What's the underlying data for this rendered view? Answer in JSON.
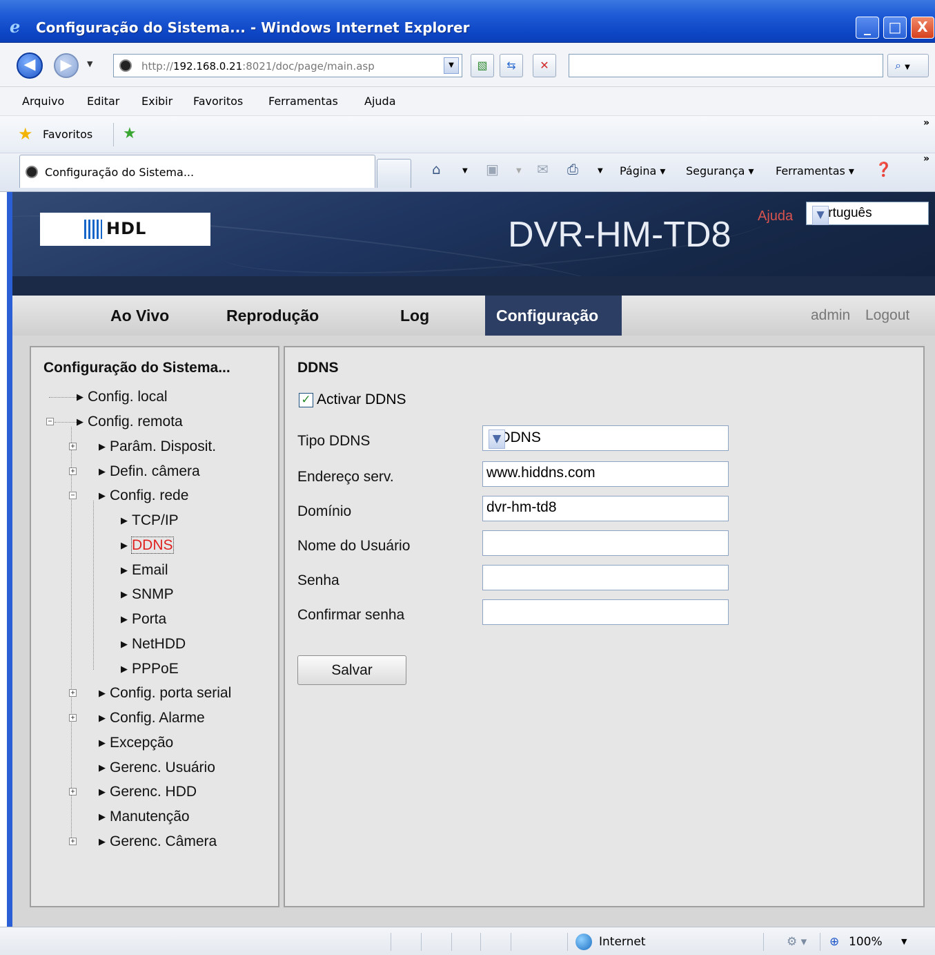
{
  "window": {
    "title": "Configuração do Sistema... - Windows Internet Explorer",
    "minimize_glyph": "_",
    "maximize_glyph": "□",
    "close_glyph": "X"
  },
  "addressbar": {
    "url_prefix": "http://",
    "url_host": "192.168.0.21",
    "url_rest": ":8021/doc/page/main.asp",
    "search_value": ""
  },
  "menu": [
    "Arquivo",
    "Editar",
    "Exibir",
    "Favoritos",
    "Ferramentas",
    "Ajuda"
  ],
  "favorites_bar": {
    "label": "Favoritos"
  },
  "tab": {
    "title": "Configuração do Sistema..."
  },
  "command_bar": {
    "page": "Página ▾",
    "security": "Segurança ▾",
    "tools": "Ferramentas ▾"
  },
  "header": {
    "logo_text": "HDL",
    "model": "DVR-HM-TD8",
    "help": "Ajuda",
    "language": "Português"
  },
  "nav": {
    "tabs": [
      "Ao Vivo",
      "Reprodução",
      "Log",
      "Configuração"
    ],
    "active": "Configuração",
    "user": "admin",
    "logout": "Logout"
  },
  "tree": {
    "title": "Configuração do Sistema...",
    "items": [
      {
        "label": "Config. local"
      },
      {
        "label": "Config. remota"
      },
      {
        "label": "Parâm. Disposit."
      },
      {
        "label": "Defin. câmera"
      },
      {
        "label": "Config. rede"
      },
      {
        "label": "TCP/IP"
      },
      {
        "label": "DDNS",
        "selected": true
      },
      {
        "label": "Email"
      },
      {
        "label": "SNMP"
      },
      {
        "label": "Porta"
      },
      {
        "label": "NetHDD"
      },
      {
        "label": "PPPoE"
      },
      {
        "label": "Config. porta serial"
      },
      {
        "label": "Config. Alarme"
      },
      {
        "label": "Excepção"
      },
      {
        "label": "Gerenc. Usuário"
      },
      {
        "label": "Gerenc. HDD"
      },
      {
        "label": "Manutenção"
      },
      {
        "label": "Gerenc. Câmera"
      }
    ]
  },
  "ddns": {
    "title": "DDNS",
    "enable_label": "Activar DDNS",
    "enabled": true,
    "type_label": "Tipo DDNS",
    "type_value": "hiDDNS",
    "server_label": "Endereço serv.",
    "server_value": "www.hiddns.com",
    "domain_label": "Domínio",
    "domain_value": "dvr-hm-td8",
    "user_label": "Nome do Usuário",
    "user_value": "",
    "password_label": "Senha",
    "password_value": "",
    "confirm_label": "Confirmar senha",
    "confirm_value": "",
    "save_label": "Salvar"
  },
  "status": {
    "zone": "Internet",
    "zoom": "100%"
  }
}
